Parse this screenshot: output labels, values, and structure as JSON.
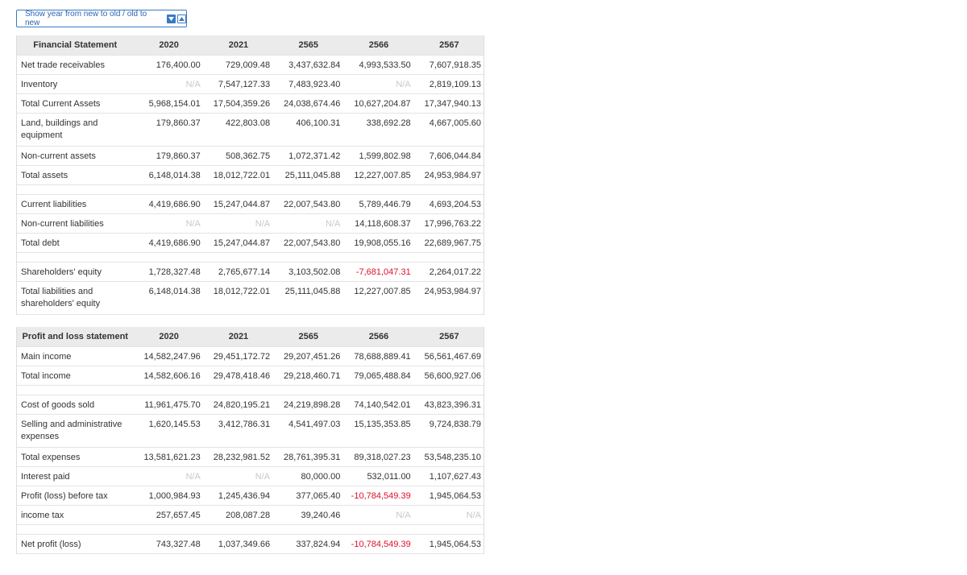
{
  "toggle": {
    "label": "Show year from new to old / old to new"
  },
  "balance": {
    "header": [
      "Financial Statement",
      "2020",
      "2021",
      "2565",
      "2566",
      "2567"
    ],
    "groups": [
      [
        {
          "label": "Net trade receivables",
          "values": [
            "176,400.00",
            "729,009.48",
            "3,437,632.84",
            "4,993,533.50",
            "7,607,918.35"
          ]
        },
        {
          "label": "Inventory",
          "values": [
            "N/A",
            "7,547,127.33",
            "7,483,923.40",
            "N/A",
            "2,819,109.13"
          ]
        },
        {
          "label": "Total Current Assets",
          "values": [
            "5,968,154.01",
            "17,504,359.26",
            "24,038,674.46",
            "10,627,204.87",
            "17,347,940.13"
          ]
        },
        {
          "label": "Land, buildings and equipment",
          "tall": true,
          "values": [
            "179,860.37",
            "422,803.08",
            "406,100.31",
            "338,692.28",
            "4,667,005.60"
          ]
        },
        {
          "label": "Non-current assets",
          "values": [
            "179,860.37",
            "508,362.75",
            "1,072,371.42",
            "1,599,802.98",
            "7,606,044.84"
          ]
        },
        {
          "label": "Total assets",
          "values": [
            "6,148,014.38",
            "18,012,722.01",
            "25,111,045.88",
            "12,227,007.85",
            "24,953,984.97"
          ]
        }
      ],
      [
        {
          "label": "Current liabilities",
          "values": [
            "4,419,686.90",
            "15,247,044.87",
            "22,007,543.80",
            "5,789,446.79",
            "4,693,204.53"
          ]
        },
        {
          "label": "Non-current liabilities",
          "values": [
            "N/A",
            "N/A",
            "N/A",
            "14,118,608.37",
            "17,996,763.22"
          ]
        },
        {
          "label": "Total debt",
          "values": [
            "4,419,686.90",
            "15,247,044.87",
            "22,007,543.80",
            "19,908,055.16",
            "22,689,967.75"
          ]
        }
      ],
      [
        {
          "label": "Shareholders' equity",
          "values": [
            "1,728,327.48",
            "2,765,677.14",
            "3,103,502.08",
            "-7,681,047.31",
            "2,264,017.22"
          ]
        },
        {
          "label": "Total liabilities and shareholders' equity",
          "tall": true,
          "values": [
            "6,148,014.38",
            "18,012,722.01",
            "25,111,045.88",
            "12,227,007.85",
            "24,953,984.97"
          ]
        }
      ]
    ]
  },
  "pnl": {
    "header": [
      "Profit and loss statement",
      "2020",
      "2021",
      "2565",
      "2566",
      "2567"
    ],
    "groups": [
      [
        {
          "label": "Main income",
          "values": [
            "14,582,247.96",
            "29,451,172.72",
            "29,207,451.26",
            "78,688,889.41",
            "56,561,467.69"
          ]
        },
        {
          "label": "Total income",
          "values": [
            "14,582,606.16",
            "29,478,418.46",
            "29,218,460.71",
            "79,065,488.84",
            "56,600,927.06"
          ]
        }
      ],
      [
        {
          "label": "Cost of goods sold",
          "values": [
            "11,961,475.70",
            "24,820,195.21",
            "24,219,898.28",
            "74,140,542.01",
            "43,823,396.31"
          ]
        },
        {
          "label": "Selling and administrative expenses",
          "tall": true,
          "values": [
            "1,620,145.53",
            "3,412,786.31",
            "4,541,497.03",
            "15,135,353.85",
            "9,724,838.79"
          ]
        },
        {
          "label": "Total expenses",
          "values": [
            "13,581,621.23",
            "28,232,981.52",
            "28,761,395.31",
            "89,318,027.23",
            "53,548,235.10"
          ]
        },
        {
          "label": "Interest paid",
          "values": [
            "N/A",
            "N/A",
            "80,000.00",
            "532,011.00",
            "1,107,627.43"
          ]
        },
        {
          "label": "Profit (loss) before tax",
          "values": [
            "1,000,984.93",
            "1,245,436.94",
            "377,065.40",
            "-10,784,549.39",
            "1,945,064.53"
          ]
        },
        {
          "label": "income tax",
          "values": [
            "257,657.45",
            "208,087.28",
            "39,240.46",
            "N/A",
            "N/A"
          ]
        }
      ],
      [
        {
          "label": "Net profit (loss)",
          "values": [
            "743,327.48",
            "1,037,349.66",
            "337,824.94",
            "-10,784,549.39",
            "1,945,064.53"
          ]
        }
      ]
    ]
  },
  "colors": {
    "negative": "#e0102a",
    "na": "#c8c8c8",
    "accent": "#3a79c4"
  }
}
